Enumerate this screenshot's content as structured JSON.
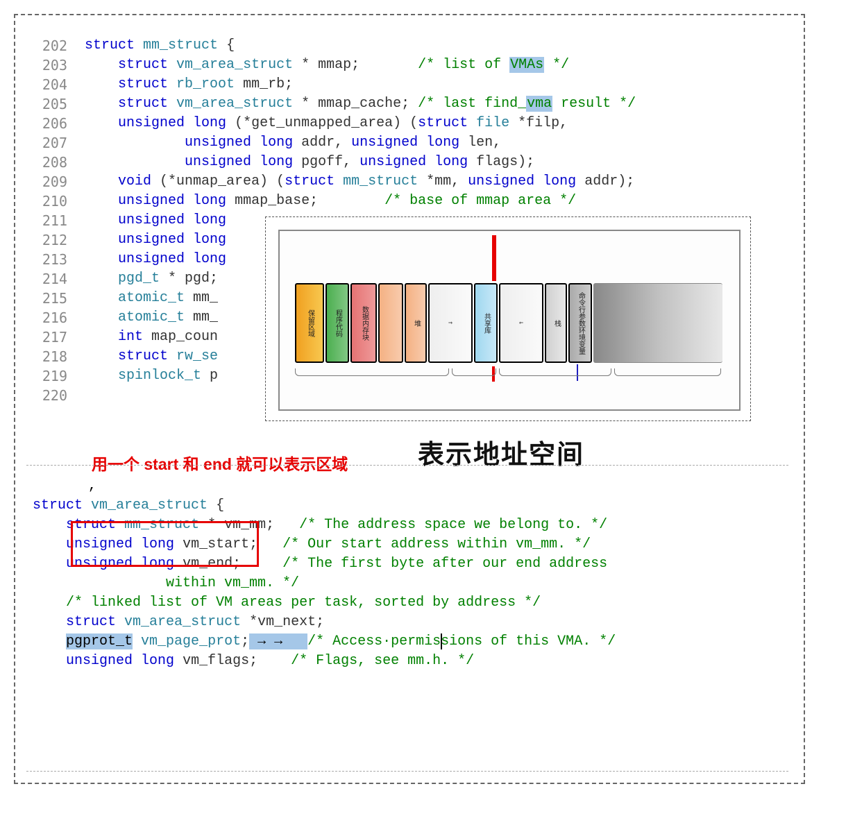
{
  "code1": {
    "lines": [
      {
        "num": "202",
        "parts": [
          {
            "kw": "struct"
          },
          {
            "sp": " "
          },
          {
            "type": "mm_struct"
          },
          {
            "sp": " {"
          }
        ]
      },
      {
        "num": "203",
        "indent": 1,
        "parts": [
          {
            "kw": "struct"
          },
          {
            "sp": " "
          },
          {
            "type": "vm_area_struct"
          },
          {
            "sp": " * mmap;       "
          },
          {
            "comment": "/* list of "
          },
          {
            "hl": "VMAs"
          },
          {
            "comment": " */"
          }
        ]
      },
      {
        "num": "204",
        "indent": 1,
        "parts": [
          {
            "kw": "struct"
          },
          {
            "sp": " "
          },
          {
            "type": "rb_root"
          },
          {
            "sp": " mm_rb;"
          }
        ]
      },
      {
        "num": "205",
        "indent": 1,
        "parts": [
          {
            "kw": "struct"
          },
          {
            "sp": " "
          },
          {
            "type": "vm_area_struct"
          },
          {
            "sp": " * mmap_cache; "
          },
          {
            "comment": "/* last find_"
          },
          {
            "hl": "vma"
          },
          {
            "comment": " result */"
          }
        ]
      },
      {
        "num": "206",
        "indent": 1,
        "parts": [
          {
            "kw": "unsigned"
          },
          {
            "sp": " "
          },
          {
            "kw": "long"
          },
          {
            "sp": " (*get_unmapped_area) ("
          },
          {
            "kw": "struct"
          },
          {
            "sp": " "
          },
          {
            "type": "file"
          },
          {
            "sp": " *filp,"
          }
        ]
      },
      {
        "num": "207",
        "indent": 3,
        "parts": [
          {
            "kw": "unsigned"
          },
          {
            "sp": " "
          },
          {
            "kw": "long"
          },
          {
            "sp": " addr, "
          },
          {
            "kw": "unsigned"
          },
          {
            "sp": " "
          },
          {
            "kw": "long"
          },
          {
            "sp": " len,"
          }
        ]
      },
      {
        "num": "208",
        "indent": 3,
        "parts": [
          {
            "kw": "unsigned"
          },
          {
            "sp": " "
          },
          {
            "kw": "long"
          },
          {
            "sp": " pgoff, "
          },
          {
            "kw": "unsigned"
          },
          {
            "sp": " "
          },
          {
            "kw": "long"
          },
          {
            "sp": " flags);"
          }
        ]
      },
      {
        "num": "209",
        "indent": 1,
        "parts": [
          {
            "kw": "void"
          },
          {
            "sp": " (*unmap_area) ("
          },
          {
            "kw": "struct"
          },
          {
            "sp": " "
          },
          {
            "type": "mm_struct"
          },
          {
            "sp": " *mm, "
          },
          {
            "kw": "unsigned"
          },
          {
            "sp": " "
          },
          {
            "kw": "long"
          },
          {
            "sp": " addr);"
          }
        ]
      },
      {
        "num": "210",
        "indent": 1,
        "parts": [
          {
            "kw": "unsigned"
          },
          {
            "sp": " "
          },
          {
            "kw": "long"
          },
          {
            "sp": " mmap_base;        "
          },
          {
            "comment": "/* base of mmap area */"
          }
        ]
      },
      {
        "num": "211",
        "indent": 1,
        "parts": [
          {
            "kw": "unsigned"
          },
          {
            "sp": " "
          },
          {
            "kw": "long"
          },
          {
            "trunc": ""
          }
        ]
      },
      {
        "num": "212",
        "indent": 1,
        "parts": [
          {
            "kw": "unsigned"
          },
          {
            "sp": " "
          },
          {
            "kw": "long"
          },
          {
            "trunc": ""
          }
        ]
      },
      {
        "num": "213",
        "indent": 1,
        "parts": [
          {
            "kw": "unsigned"
          },
          {
            "sp": " "
          },
          {
            "kw": "long"
          },
          {
            "trunc": ""
          }
        ]
      },
      {
        "num": "214",
        "indent": 1,
        "parts": [
          {
            "type": "pgd_t"
          },
          {
            "sp": " * pgd;"
          }
        ]
      },
      {
        "num": "215",
        "indent": 1,
        "parts": [
          {
            "type": "atomic_t"
          },
          {
            "sp": " mm_"
          }
        ]
      },
      {
        "num": "216",
        "indent": 1,
        "parts": [
          {
            "type": "atomic_t"
          },
          {
            "sp": " mm_"
          }
        ]
      },
      {
        "num": "217",
        "indent": 1,
        "parts": [
          {
            "kw": "int"
          },
          {
            "sp": " map_coun"
          }
        ]
      },
      {
        "num": "218",
        "indent": 1,
        "parts": [
          {
            "kw": "struct"
          },
          {
            "sp": " "
          },
          {
            "type": "rw_se"
          }
        ]
      },
      {
        "num": "219",
        "indent": 1,
        "parts": [
          {
            "type": "spinlock_t"
          },
          {
            "sp": " p"
          }
        ]
      },
      {
        "num": "220",
        "parts": []
      }
    ]
  },
  "diagram": {
    "segments": [
      {
        "label": "保留区域",
        "cls": "orange"
      },
      {
        "label": "程序代码",
        "cls": "green"
      },
      {
        "label": "数据内存块",
        "cls": "red"
      },
      {
        "label": "",
        "cls": "peach"
      },
      {
        "label": "堆",
        "cls": "heap"
      },
      {
        "label": "⇒",
        "cls": "gray1"
      },
      {
        "label": "共享库",
        "cls": "blue"
      },
      {
        "label": "⇐",
        "cls": "gray2"
      },
      {
        "label": "栈",
        "cls": "stack"
      },
      {
        "label": "命令行参数环境变量",
        "cls": "daa"
      },
      {
        "label": "",
        "cls": "kernel"
      }
    ]
  },
  "annotations": {
    "red_label": "用一个 start 和 end 就可以表示区域",
    "big_title": "表示地址空间"
  },
  "code2": {
    "lines": [
      {
        "parts": [
          {
            "kw": "struct"
          },
          {
            "sp": " "
          },
          {
            "type": "vm_area_struct"
          },
          {
            "sp": " {"
          }
        ]
      },
      {
        "indent": 1,
        "parts": [
          {
            "kw": "struct"
          },
          {
            "sp": " "
          },
          {
            "type": "mm_struct"
          },
          {
            "sp": " * vm_mm;   "
          },
          {
            "comment": "/* The address space we belong to. */"
          }
        ]
      },
      {
        "indent": 1,
        "boxed": true,
        "parts": [
          {
            "kw": "unsigned"
          },
          {
            "sp": " "
          },
          {
            "kw": "long"
          },
          {
            "sp": " vm_start;   "
          },
          {
            "comment": "/* Our start address within vm_mm. */"
          }
        ]
      },
      {
        "indent": 1,
        "boxed": true,
        "parts": [
          {
            "kw": "unsigned"
          },
          {
            "sp": " "
          },
          {
            "kw": "long"
          },
          {
            "sp": " vm_end;     "
          },
          {
            "comment": "/* The first byte after our end address"
          }
        ]
      },
      {
        "indent": 4,
        "parts": [
          {
            "comment": "within vm_mm. */"
          }
        ]
      },
      {
        "indent": 0,
        "parts": []
      },
      {
        "indent": 1,
        "parts": [
          {
            "comment": "/* linked list of VM areas per task, sorted by address */"
          }
        ]
      },
      {
        "indent": 1,
        "parts": [
          {
            "kw": "struct"
          },
          {
            "sp": " "
          },
          {
            "type": "vm_area_struct"
          },
          {
            "sp": " *vm_next;"
          }
        ]
      },
      {
        "indent": 0,
        "parts": []
      },
      {
        "indent": 1,
        "parts": [
          {
            "sel": "pgprot_t"
          },
          {
            "sp": " "
          },
          {
            "type": "vm_page_prot"
          },
          {
            "sp": ";"
          },
          {
            "sel": " → →   "
          },
          {
            "comment": "/* Access·permi"
          },
          {
            "cursor": "s"
          },
          {
            "comment": "sions of this VMA. */"
          }
        ]
      },
      {
        "indent": 1,
        "parts": [
          {
            "kw": "unsigned"
          },
          {
            "sp": " "
          },
          {
            "kw": "long"
          },
          {
            "sp": " vm_flags;    "
          },
          {
            "comment": "/* Flags, see mm.h. */"
          }
        ]
      }
    ]
  }
}
